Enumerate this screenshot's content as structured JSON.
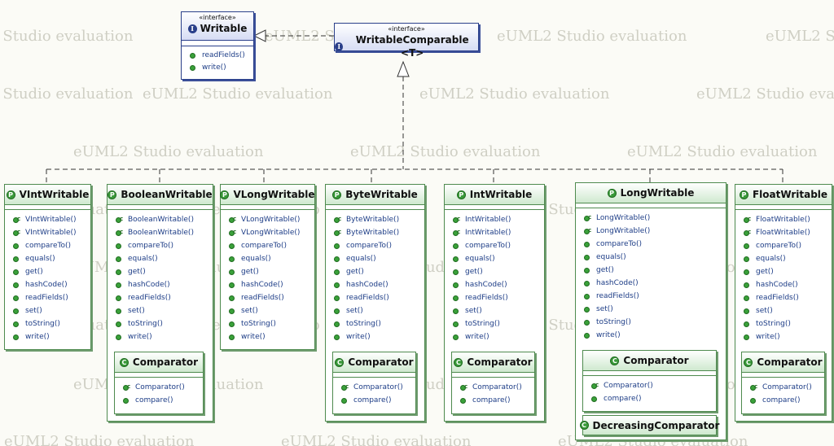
{
  "watermark": "eUML2 Studio evaluation",
  "interfaces": {
    "writable": {
      "stereotype": "«interface»",
      "name": "Writable",
      "methods": [
        "readFields()",
        "write()"
      ]
    },
    "writable_comparable": {
      "stereotype": "«interface»",
      "name": "WritableComparable <T>"
    }
  },
  "classes": [
    {
      "name": "VIntWritable",
      "constructors": [
        "VIntWritable()",
        "VIntWritable()"
      ],
      "methods": [
        "compareTo()",
        "equals()",
        "get()",
        "hashCode()",
        "readFields()",
        "set()",
        "toString()",
        "write()"
      ]
    },
    {
      "name": "BooleanWritable",
      "constructors": [
        "BooleanWritable()",
        "BooleanWritable()"
      ],
      "methods": [
        "compareTo()",
        "equals()",
        "get()",
        "hashCode()",
        "readFields()",
        "set()",
        "toString()",
        "write()"
      ]
    },
    {
      "name": "VLongWritable",
      "constructors": [
        "VLongWritable()",
        "VLongWritable()"
      ],
      "methods": [
        "compareTo()",
        "equals()",
        "get()",
        "hashCode()",
        "readFields()",
        "set()",
        "toString()",
        "write()"
      ]
    },
    {
      "name": "ByteWritable",
      "constructors": [
        "ByteWritable()",
        "ByteWritable()"
      ],
      "methods": [
        "compareTo()",
        "equals()",
        "get()",
        "hashCode()",
        "readFields()",
        "set()",
        "toString()",
        "write()"
      ]
    },
    {
      "name": "IntWritable",
      "constructors": [
        "IntWritable()",
        "IntWritable()"
      ],
      "methods": [
        "compareTo()",
        "equals()",
        "get()",
        "hashCode()",
        "readFields()",
        "set()",
        "toString()",
        "write()"
      ]
    },
    {
      "name": "LongWritable",
      "constructors": [
        "LongWritable()",
        "LongWritable()"
      ],
      "methods": [
        "compareTo()",
        "equals()",
        "get()",
        "hashCode()",
        "readFields()",
        "set()",
        "toString()",
        "write()"
      ]
    },
    {
      "name": "FloatWritable",
      "constructors": [
        "FloatWritable()",
        "FloatWritable()"
      ],
      "methods": [
        "compareTo()",
        "equals()",
        "get()",
        "hashCode()",
        "readFields()",
        "set()",
        "toString()",
        "write()"
      ]
    }
  ],
  "nested": {
    "comparator": {
      "name": "Comparator",
      "constructors": [
        "Comparator()"
      ],
      "methods": [
        "compare()"
      ]
    },
    "decreasing_comparator": {
      "name": "DecreasingComparator"
    }
  },
  "icons": {
    "class_kind": "class-icon",
    "interface_kind": "interface-icon",
    "method": "public-method-icon",
    "constructor": "constructor-icon"
  },
  "colors": {
    "class_border": "#4e8a4e",
    "class_header": "#cfe9cf",
    "interface_border": "#2a3f8a",
    "method_text": "#1c3c86",
    "watermark": "#cfcfc4"
  }
}
